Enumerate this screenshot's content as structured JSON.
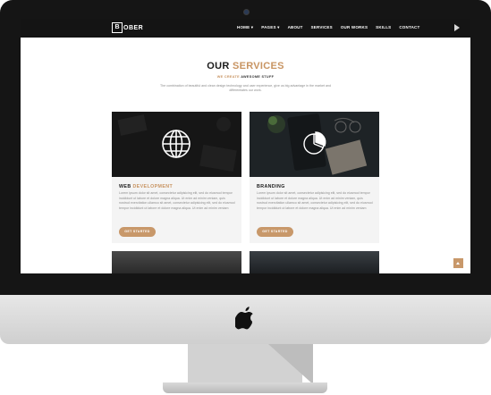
{
  "nav": {
    "logo_letter": "B",
    "logo_text": "OBER",
    "menu": [
      "HOME ▾",
      "PAGES ▾",
      "ABOUT",
      "SERVICES",
      "OUR WORKS",
      "SKILLS",
      "CONTACT"
    ]
  },
  "section": {
    "title_a": "OUR",
    "title_b": "SERVICES",
    "subtitle_a": "WE CREATE",
    "subtitle_b": "AWESOME STUFF",
    "description": "The combination of beautiful and clean design technology and user experience, give us big advantage in the market and differentiates our work."
  },
  "cards": [
    {
      "title_a": "WEB",
      "title_b": "DEVELOPMENT",
      "text": "Lorem ipsum dolor sit amet, consectetur adipisicing elit, sed do eiusmod tempor incididunt ut labore et dolore magna aliqua. Ut enim ad minim veniam, quis nostrud exercitation ullamco sit amet, consectetur adipisicing elit, sed do eiusmod tempor incididunt ut labore et dolore magna aliqua. Ut enim ad minim veniam",
      "button": "GET STARTED",
      "icon": "globe-icon"
    },
    {
      "title_a": "BRANDING",
      "title_b": "",
      "text": "Lorem ipsum dolor sit amet, consectetur adipisicing elit, sed do eiusmod tempor incididunt ut labore et dolore magna aliqua. Ut enim ad minim veniam, quis nostrud exercitation ullamco sit amet, consectetur adipisicing elit, sed do eiusmod tempor incididunt ut labore et dolore magna aliqua. Ut enim ad minim veniam",
      "button": "GET STARTED",
      "icon": "pie-chart-icon"
    }
  ],
  "colors": {
    "accent": "#c89462",
    "nav_bg": "#141414",
    "card_bg": "#f4f4f4"
  }
}
